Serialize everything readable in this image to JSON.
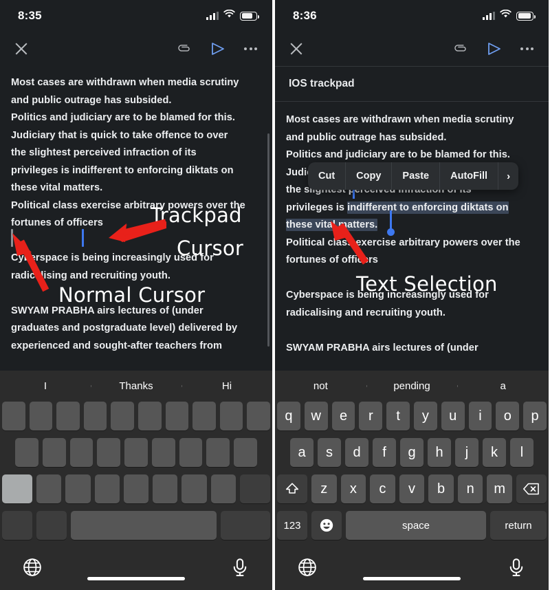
{
  "left": {
    "status": {
      "time": "8:35",
      "signal_icon": "cellular-signal-icon",
      "wifi_icon": "wifi-icon",
      "battery_icon": "battery-icon"
    },
    "toolbar": {
      "close_icon": "close-icon",
      "attach_icon": "paperclip-icon",
      "send_icon": "send-icon",
      "more_icon": "more-options-icon"
    },
    "body": [
      "Most cases are withdrawn when media scrutiny",
      "and public outrage has subsided.",
      "Politics and judiciary are to be blamed for this.",
      "Judiciary that is quick to take offence to over",
      "the slightest perceived infraction of its",
      "privileges is indifferent to enforcing diktats on",
      "these vital matters.",
      "Political class exercise arbitrary powers over the",
      "fortunes of officers",
      "Cyberspace is being increasingly used for",
      "radicalising and recruiting youth.",
      "SWYAM PRABHA airs lectures of (under",
      "graduates and postgraduate level) delivered by",
      "experienced and sought-after teachers from"
    ],
    "annotations": {
      "trackpad_line1": "Trackpad",
      "trackpad_line2": "Cursor",
      "normal": "Normal Cursor"
    },
    "keyboard": {
      "suggestions": [
        "I",
        "Thanks",
        "Hi"
      ],
      "row1": [
        "",
        "",
        "",
        "",
        "",
        "",
        "",
        "",
        "",
        ""
      ],
      "row2": [
        "",
        "",
        "",
        "",
        "",
        "",
        "",
        "",
        ""
      ],
      "row3": [
        "",
        "",
        "",
        "",
        "",
        "",
        "",
        "",
        ""
      ],
      "row4": [
        "",
        "",
        "",
        ""
      ],
      "globe_icon": "globe-icon",
      "mic_icon": "microphone-icon"
    }
  },
  "right": {
    "status": {
      "time": "8:36",
      "signal_icon": "cellular-signal-icon",
      "wifi_icon": "wifi-icon",
      "battery_icon": "battery-icon"
    },
    "toolbar": {
      "close_icon": "close-icon",
      "attach_icon": "paperclip-icon",
      "send_icon": "send-icon",
      "more_icon": "more-options-icon"
    },
    "subject": "IOS trackpad",
    "body": [
      "Most cases are withdrawn when media scrutiny",
      "and public outrage has subsided.",
      "Politics and judiciary are to be blamed for this.",
      "Judiciary that is quick to take offence to over",
      "the slightest perceived infraction of its",
      "privileges is ",
      "indifferent to enforcing diktats on",
      "these vital matters.",
      "Political class exercise arbitrary powers over the",
      "fortunes of officers",
      "Cyberspace is being increasingly used for",
      "radicalising and recruiting youth.",
      "SWYAM PRABHA airs lectures of (under"
    ],
    "context_menu": [
      "Cut",
      "Copy",
      "Paste",
      "AutoFill"
    ],
    "context_menu_more_icon": "chevron-right-icon",
    "annotations": {
      "selection": "Text Selection"
    },
    "keyboard": {
      "suggestions": [
        "not",
        "pending",
        "a"
      ],
      "row1": [
        "q",
        "w",
        "e",
        "r",
        "t",
        "y",
        "u",
        "i",
        "o",
        "p"
      ],
      "row2": [
        "a",
        "s",
        "d",
        "f",
        "g",
        "h",
        "j",
        "k",
        "l"
      ],
      "row3": [
        "z",
        "x",
        "c",
        "v",
        "b",
        "n",
        "m"
      ],
      "shift_icon": "shift-icon",
      "backspace_icon": "backspace-icon",
      "numeric_label": "123",
      "emoji_icon": "emoji-icon",
      "space_label": "space",
      "return_label": "return",
      "globe_icon": "globe-icon",
      "mic_icon": "microphone-icon"
    }
  },
  "colors": {
    "background": "#1c1f22",
    "accent": "#3d78f0",
    "selection": "#3b4658",
    "annotation_arrow": "#e8211a",
    "keyboard_bg": "#2c2c2c",
    "key_bg": "#565656"
  }
}
